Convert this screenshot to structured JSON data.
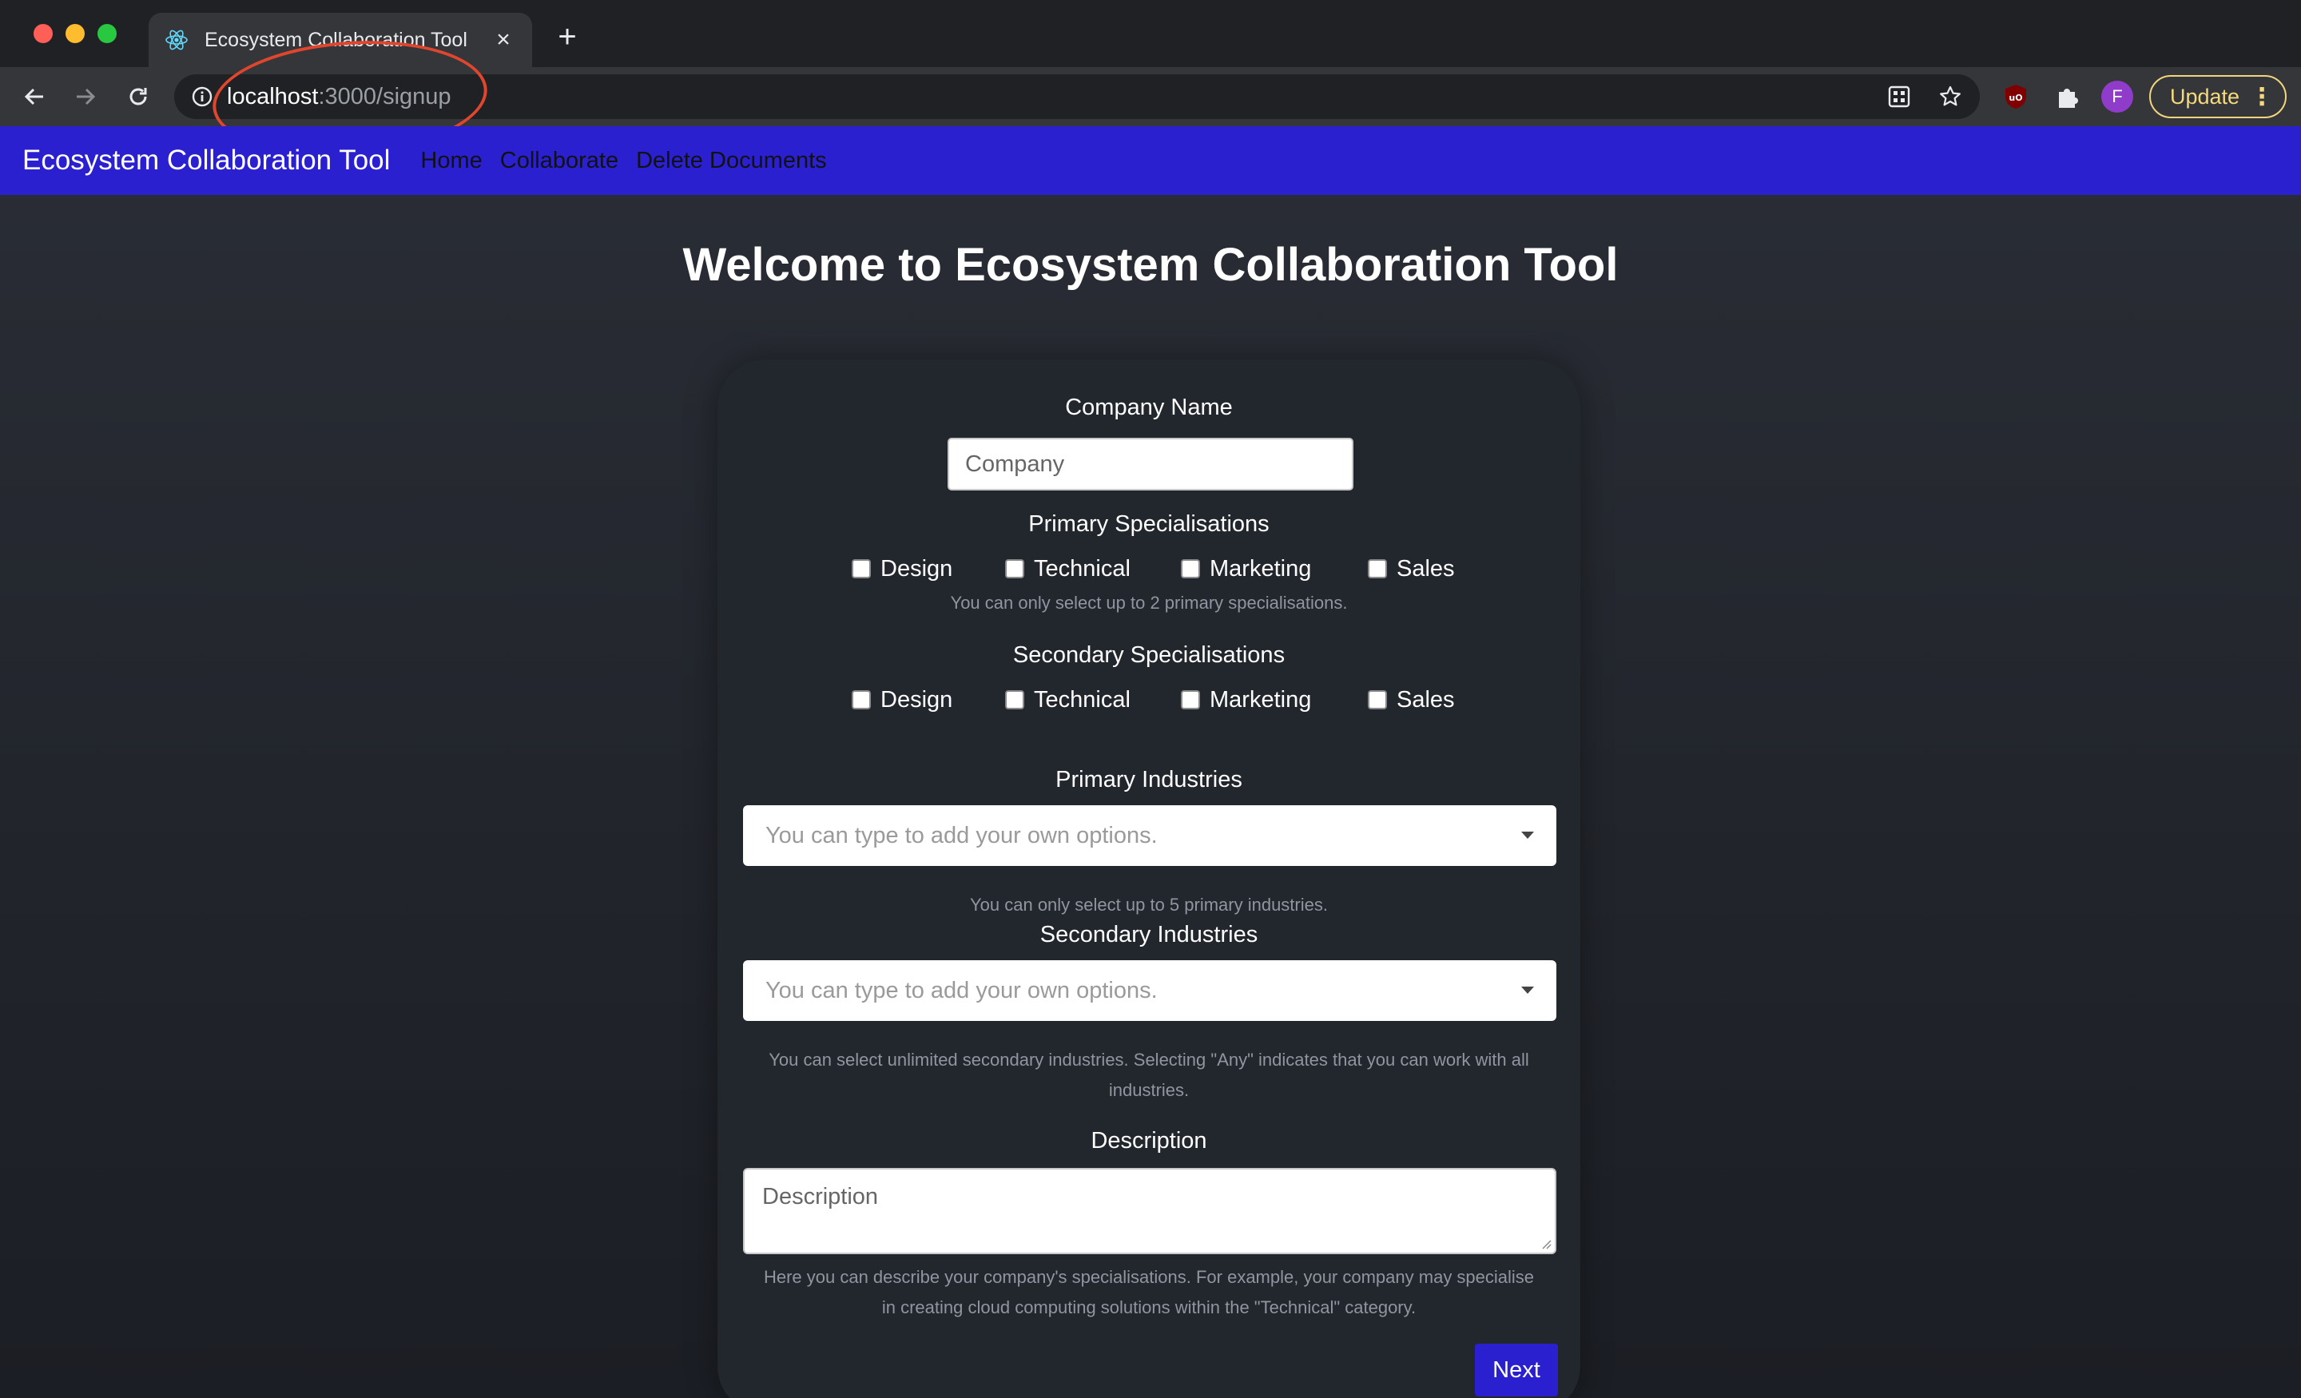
{
  "browser": {
    "tab_title": "Ecosystem Collaboration Tool",
    "url_host": "localhost",
    "url_path": ":3000/signup",
    "avatar_letter": "F",
    "update_label": "Update",
    "annotation_color": "#e0462e"
  },
  "nav": {
    "brand": "Ecosystem Collaboration Tool",
    "links": [
      "Home",
      "Collaborate",
      "Delete Documents"
    ],
    "background": "#2a20d0"
  },
  "page": {
    "title": "Welcome to Ecosystem Collaboration Tool",
    "company_label": "Company Name",
    "company_placeholder": "Company",
    "primary_spec_label": "Primary Specialisations",
    "primary_spec_options": [
      "Design",
      "Technical",
      "Marketing",
      "Sales"
    ],
    "primary_spec_hint": "You can only select up to 2 primary specialisations.",
    "secondary_spec_label": "Secondary Specialisations",
    "secondary_spec_options": [
      "Design",
      "Technical",
      "Marketing",
      "Sales"
    ],
    "primary_ind_label": "Primary Industries",
    "primary_ind_placeholder": "You can type to add your own options.",
    "primary_ind_hint": "You can only select up to 5 primary industries.",
    "secondary_ind_label": "Secondary Industries",
    "secondary_ind_placeholder": "You can type to add your own options.",
    "secondary_ind_hint": "You can select unlimited secondary industries. Selecting \"Any\" indicates that you can work with all industries.",
    "description_label": "Description",
    "description_placeholder": "Description",
    "description_hint": "Here you can describe your company's specialisations. For example, your company may specialise in creating cloud computing solutions within the \"Technical\" category.",
    "next_label": "Next"
  }
}
